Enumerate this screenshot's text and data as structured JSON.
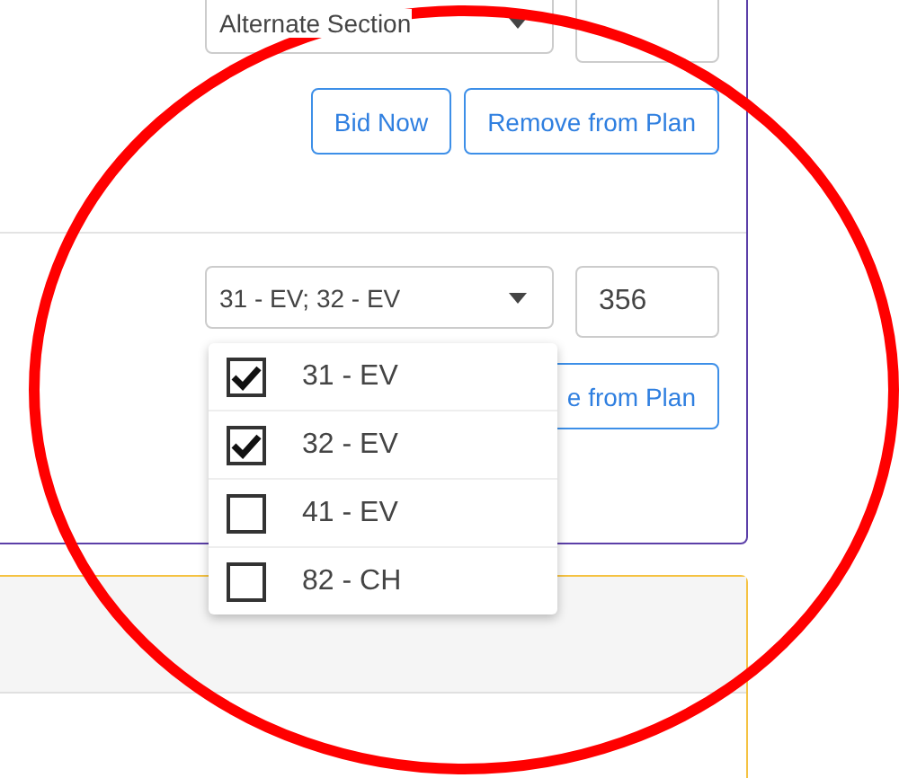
{
  "plan_card": {
    "sections": [
      {
        "select": {
          "value": "Alternate Section"
        },
        "buttons": [
          "Bid Now",
          "Remove from Plan"
        ]
      },
      {
        "select": {
          "value": "31 - EV; 32 - EV"
        },
        "quantity": "356",
        "buttons": [
          "e from Plan"
        ]
      }
    ]
  },
  "dropdown": {
    "options": [
      {
        "label": "31 - EV",
        "checked": true
      },
      {
        "label": "32 - EV",
        "checked": true
      },
      {
        "label": "41 - EV",
        "checked": false
      },
      {
        "label": "82 - CH",
        "checked": false
      }
    ]
  }
}
